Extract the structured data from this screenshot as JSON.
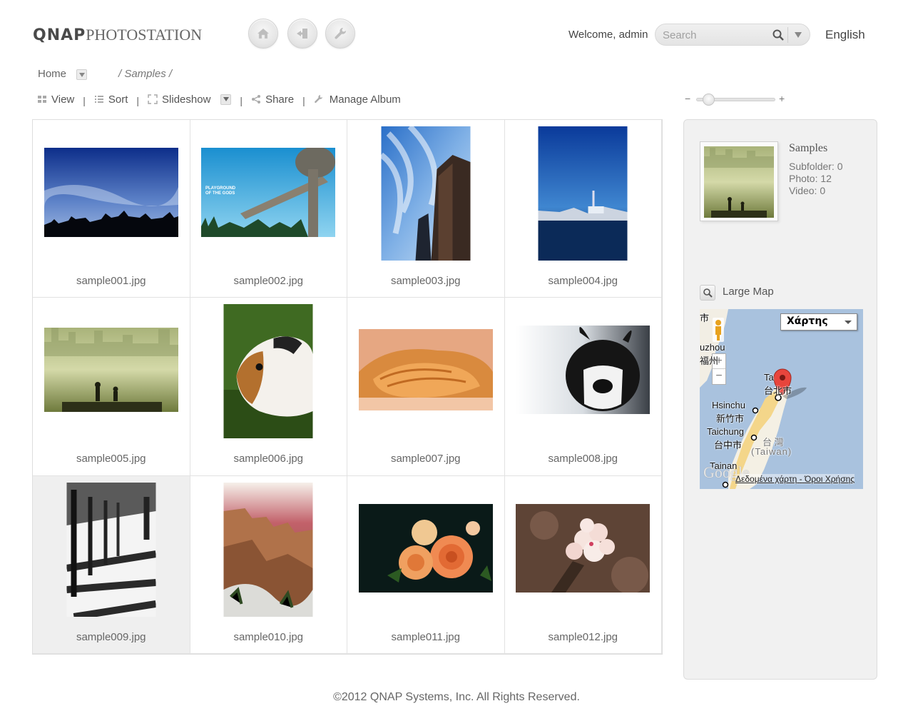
{
  "header": {
    "logo_brand": "QNAP",
    "logo_product": "PHOTOSTATION",
    "welcome": "Welcome, admin",
    "search_placeholder": "Search",
    "language": "English",
    "icons": [
      "home-icon",
      "logout-icon",
      "wrench-icon"
    ]
  },
  "breadcrumb": {
    "home": "Home",
    "path": "/ Samples /"
  },
  "toolbar": {
    "view": "View",
    "sort": "Sort",
    "slideshow": "Slideshow",
    "share": "Share",
    "manage_album": "Manage Album",
    "separator": "|"
  },
  "zoom": {
    "minus": "−",
    "plus": "+",
    "level": 0.1
  },
  "photos": [
    {
      "name": "sample001.jpg",
      "subject": "sky-silhouette",
      "orientation": "landscape"
    },
    {
      "name": "sample002.jpg",
      "subject": "playground-sky",
      "orientation": "landscape"
    },
    {
      "name": "sample003.jpg",
      "subject": "skyscraper",
      "orientation": "portrait"
    },
    {
      "name": "sample004.jpg",
      "subject": "harbor-boats",
      "orientation": "portrait"
    },
    {
      "name": "sample005.jpg",
      "subject": "foggy-city",
      "orientation": "landscape"
    },
    {
      "name": "sample006.jpg",
      "subject": "guinea-pig",
      "orientation": "portrait"
    },
    {
      "name": "sample007.jpg",
      "subject": "sleeping-cat",
      "orientation": "landscape"
    },
    {
      "name": "sample008.jpg",
      "subject": "rabbit",
      "orientation": "landscape"
    },
    {
      "name": "sample009.jpg",
      "subject": "tree-alley-bw",
      "orientation": "portrait"
    },
    {
      "name": "sample010.jpg",
      "subject": "canyon",
      "orientation": "portrait"
    },
    {
      "name": "sample011.jpg",
      "subject": "roses",
      "orientation": "landscape"
    },
    {
      "name": "sample012.jpg",
      "subject": "cherry-blossom",
      "orientation": "landscape"
    }
  ],
  "selected_photo": "sample009.jpg",
  "album": {
    "name": "Samples",
    "subfolder": "Subfolder: 0",
    "photo": "Photo: 12",
    "video": "Video: 0"
  },
  "map": {
    "large_map_label": "Large Map",
    "map_type": "Χάρτης",
    "labels": {
      "top_left": "市",
      "fuzhou": "uzhou",
      "fuzhou_cn": "福州",
      "taipei": "Ta",
      "taipei_cn": "台北市",
      "hsinchu": "Hsinchu",
      "hsinchu_cn": "新竹市",
      "taichung": "Taichung",
      "taichung_cn": "台中市",
      "taiwan_cn": "台 灣",
      "taiwan": "(Taiwan)",
      "tainan": "Tainan"
    },
    "google": "Google",
    "footer_data": "Δεδομένα χάρτη",
    "footer_sep": "-",
    "footer_terms": "Όροι Χρήσης"
  },
  "footer": "©2012 QNAP Systems, Inc. All Rights Reserved."
}
